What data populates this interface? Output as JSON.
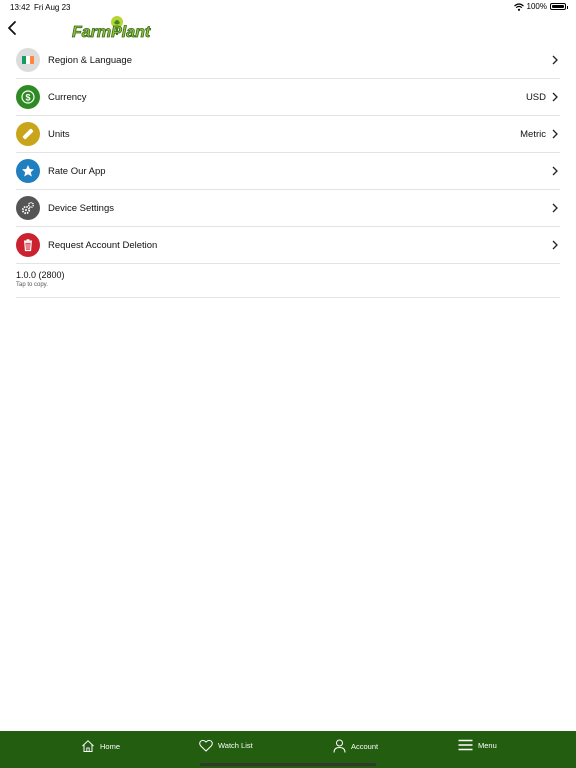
{
  "status_bar": {
    "time": "13:42",
    "date": "Fri Aug 23",
    "battery": "100%"
  },
  "header": {
    "logo_text": "FarmPlant"
  },
  "menu_items": [
    {
      "label": "Region & Language",
      "value": "",
      "icon": "ireland-flag-icon",
      "color": "#dcdcdc"
    },
    {
      "label": "Currency",
      "value": "USD",
      "icon": "dollar-icon",
      "color": "#2e8b24"
    },
    {
      "label": "Units",
      "value": "Metric",
      "icon": "ruler-icon",
      "color": "#c8a51a"
    },
    {
      "label": "Rate Our App",
      "value": "",
      "icon": "star-icon",
      "color": "#1f7fbf"
    },
    {
      "label": "Device Settings",
      "value": "",
      "icon": "gears-icon",
      "color": "#555555"
    },
    {
      "label": "Request Account Deletion",
      "value": "",
      "icon": "trash-icon",
      "color": "#cc2230"
    }
  ],
  "version": {
    "number": "1.0.0 (2800)",
    "hint": "Tap to copy."
  },
  "tab_bar": {
    "background": "#225d10",
    "tabs": [
      {
        "label": "Home",
        "icon": "home-icon"
      },
      {
        "label": "Watch List",
        "icon": "heart-icon"
      },
      {
        "label": "Account",
        "icon": "person-icon"
      },
      {
        "label": "Menu",
        "icon": "hamburger-icon",
        "active": true
      }
    ]
  }
}
